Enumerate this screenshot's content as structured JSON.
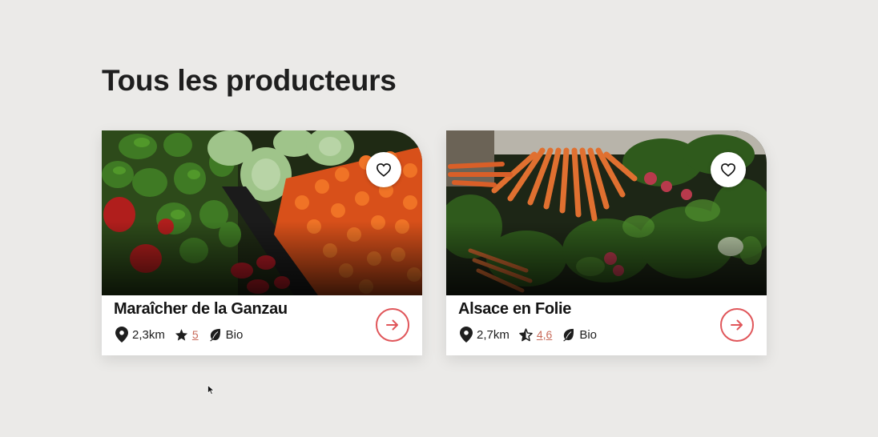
{
  "page": {
    "title": "Tous les producteurs"
  },
  "producers": [
    {
      "name": "Maraîcher de la Ganzau",
      "distance": "2,3km",
      "rating": "5",
      "rating_icon": "star-filled-icon",
      "label": "Bio",
      "image": "vegetables-peppers-cabbage-image"
    },
    {
      "name": "Alsace en Folie",
      "distance": "2,7km",
      "rating": "4,6",
      "rating_icon": "star-half-icon",
      "label": "Bio",
      "image": "vegetables-carrots-radishes-image"
    }
  ],
  "colors": {
    "background": "#ebeae8",
    "accent": "#e0565a",
    "rating_link": "#c96b5a",
    "text": "#1e1e1e"
  },
  "icons": {
    "favorite": "heart-outline-icon",
    "location": "location-pin-icon",
    "label": "leaf-icon",
    "go": "arrow-right-icon"
  }
}
